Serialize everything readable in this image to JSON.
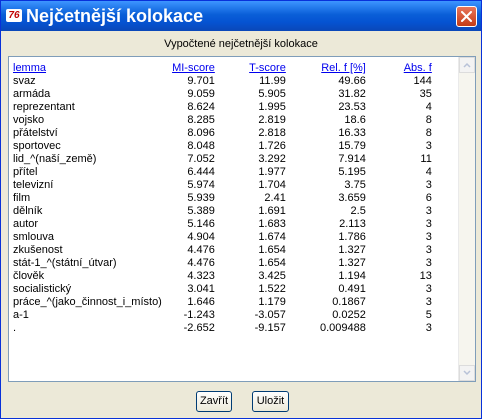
{
  "window": {
    "title": "Nejčetnější kolokace",
    "app_icon_text": "76"
  },
  "subtitle": "Vypočtené nejčetnější kolokace",
  "table": {
    "headers": [
      "lemma",
      "MI-score",
      "T-score",
      "Rel. f [%]",
      "Abs. f"
    ],
    "rows": [
      [
        "svaz",
        "9.701",
        "11.99",
        "49.66",
        "144"
      ],
      [
        "armáda",
        "9.059",
        "5.905",
        "31.82",
        "35"
      ],
      [
        "reprezentant",
        "8.624",
        "1.995",
        "23.53",
        "4"
      ],
      [
        "vojsko",
        "8.285",
        "2.819",
        "18.6",
        "8"
      ],
      [
        "přátelství",
        "8.096",
        "2.818",
        "16.33",
        "8"
      ],
      [
        "sportovec",
        "8.048",
        "1.726",
        "15.79",
        "3"
      ],
      [
        "lid_^(naší_země)",
        "7.052",
        "3.292",
        "7.914",
        "11"
      ],
      [
        "přítel",
        "6.444",
        "1.977",
        "5.195",
        "4"
      ],
      [
        "televizní",
        "5.974",
        "1.704",
        "3.75",
        "3"
      ],
      [
        "film",
        "5.939",
        "2.41",
        "3.659",
        "6"
      ],
      [
        "dělník",
        "5.389",
        "1.691",
        "2.5",
        "3"
      ],
      [
        "autor",
        "5.146",
        "1.683",
        "2.113",
        "3"
      ],
      [
        "smlouva",
        "4.904",
        "1.674",
        "1.786",
        "3"
      ],
      [
        "zkušenost",
        "4.476",
        "1.654",
        "1.327",
        "3"
      ],
      [
        "stát-1_^(státní_útvar)",
        "4.476",
        "1.654",
        "1.327",
        "3"
      ],
      [
        "člověk",
        "4.323",
        "3.425",
        "1.194",
        "13"
      ],
      [
        "socialistický",
        "3.041",
        "1.522",
        "0.491",
        "3"
      ],
      [
        "práce_^(jako_činnost_i_místo)",
        "1.646",
        "1.179",
        "0.1867",
        "3"
      ],
      [
        "a-1",
        "-1.243",
        "-3.057",
        "0.0252",
        "5"
      ],
      [
        ".",
        "-2.652",
        "-9.157",
        "0.009488",
        "3"
      ]
    ]
  },
  "buttons": {
    "close": "Zavřít",
    "save": "Uložit"
  }
}
